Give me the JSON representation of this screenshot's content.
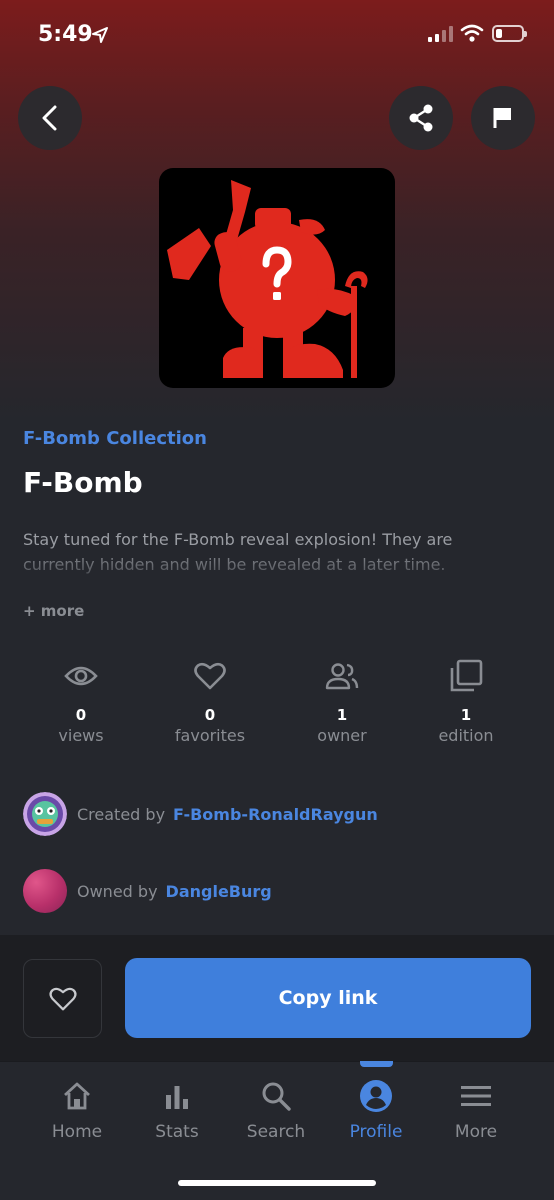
{
  "status_bar": {
    "time": "5:49"
  },
  "header": {
    "back_icon": "chevron-left-icon",
    "share_icon": "share-icon",
    "report_icon": "flag-icon"
  },
  "item": {
    "collection": "F-Bomb Collection",
    "title": "F-Bomb",
    "description": "Stay tuned for the F-Bomb reveal explosion! They are currently hidden and will be revealed at a later time.",
    "more_label": "+ more"
  },
  "stats": [
    {
      "icon": "eye-icon",
      "value": "0",
      "label": "views"
    },
    {
      "icon": "heart-icon",
      "value": "0",
      "label": "favorites"
    },
    {
      "icon": "people-icon",
      "value": "1",
      "label": "owner"
    },
    {
      "icon": "copies-icon",
      "value": "1",
      "label": "edition"
    }
  ],
  "creator": {
    "prefix": "Created by",
    "name": "F-Bomb-RonaldRaygun"
  },
  "owner": {
    "prefix": "Owned by",
    "name": "DangleBurg"
  },
  "actions": {
    "copy_label": "Copy link"
  },
  "tabs": [
    {
      "icon": "home-icon",
      "label": "Home",
      "active": false
    },
    {
      "icon": "stats-icon",
      "label": "Stats",
      "active": false
    },
    {
      "icon": "search-icon",
      "label": "Search",
      "active": false
    },
    {
      "icon": "profile-icon",
      "label": "Profile",
      "active": true
    },
    {
      "icon": "menu-icon",
      "label": "More",
      "active": false
    }
  ],
  "colors": {
    "accent": "#3f7fdc",
    "link": "#4a86e0",
    "background": "#25272d",
    "art_red": "#e0291e"
  }
}
